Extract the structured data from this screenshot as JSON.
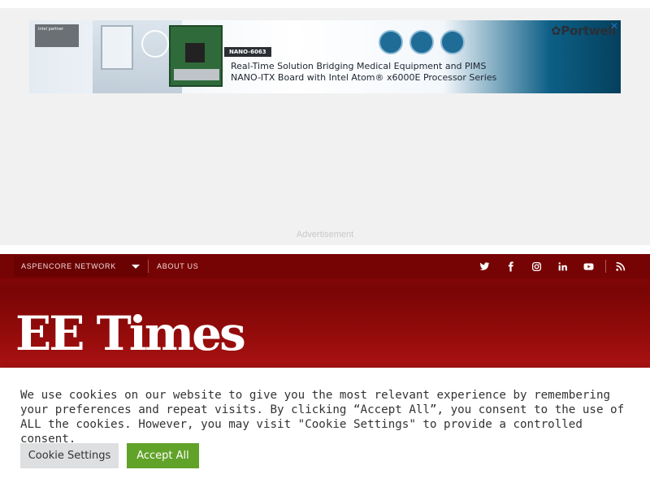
{
  "ad": {
    "partner_badge": "intel partner",
    "model": "NANO-6063",
    "headline": "Real-Time Solution Bridging Medical Equipment and PIMS",
    "subline": "NANO-ITX Board with Intel Atom® x6000E Processor Series",
    "brand": "✿Portwell",
    "close_symbol": "✕",
    "caption": "Advertisement"
  },
  "header": {
    "network_label": "ASPENCORE NETWORK",
    "about_label": "ABOUT US",
    "logo_text": "EE Times",
    "socials": [
      "twitter-icon",
      "facebook-icon",
      "instagram-icon",
      "linkedin-icon",
      "youtube-icon",
      "rss-icon"
    ]
  },
  "cookie": {
    "message": "We use cookies on our website to give you the most relevant experience by remembering your preferences and repeat visits. By clicking “Accept All”, you consent to the use of ALL the cookies. However, you may visit \"Cookie Settings\" to provide a controlled consent.",
    "settings_label": "Cookie Settings",
    "accept_label": "Accept All"
  },
  "colors": {
    "header_red": "#8d0a0a",
    "accept_green": "#61a229",
    "settings_gray": "#dedfe0"
  }
}
